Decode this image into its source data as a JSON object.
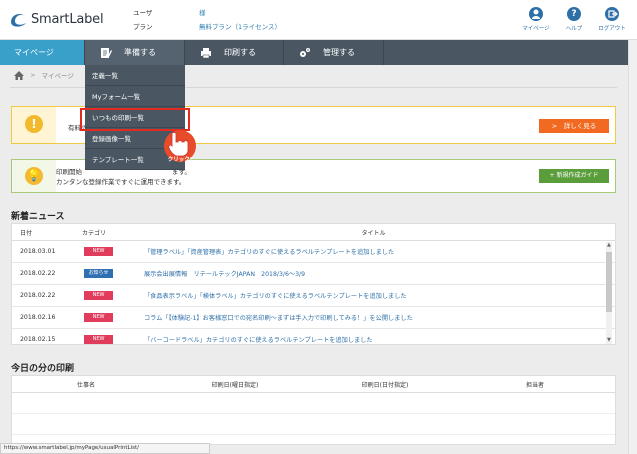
{
  "header": {
    "logo_text": "SmartLabel",
    "user_label": "ユーザ",
    "user_value": "様",
    "plan_label": "プラン",
    "plan_value": "無料プラン（1ライセンス）",
    "icons": [
      {
        "name": "mypage",
        "label": "マイページ",
        "glyph": "👤"
      },
      {
        "name": "help",
        "label": "ヘルプ",
        "glyph": "?"
      },
      {
        "name": "logout",
        "label": "ログアウト",
        "glyph": "→"
      }
    ]
  },
  "nav": {
    "mypage": "マイページ",
    "prep": "準備する",
    "print": "印刷する",
    "admin": "管理する"
  },
  "dropdown": {
    "items": [
      "定義一覧",
      "Myフォーム一覧",
      "いつもの印刷一覧",
      "登録画像一覧",
      "テンプレート一覧"
    ],
    "click_label": "クリック!"
  },
  "breadcrumb": {
    "home": "🏠",
    "sep": ">",
    "current": "マイページ"
  },
  "alert1": {
    "message": "有料の",
    "button": ">　詳しく見る"
  },
  "alert2": {
    "line1": "印刷開始",
    "line1_tail": "ます。",
    "line2": "カンタンな登録作業ですぐに運用できます。",
    "button": "+ 新規作成ガイド"
  },
  "news": {
    "title": "新着ニュース",
    "headers": {
      "date": "日付",
      "category": "カテゴリ",
      "title": "タイトル"
    },
    "rows": [
      {
        "date": "2018.03.01",
        "badge": "NEW",
        "type": "new",
        "title": "「管理ラベル」「資産管理表」カテゴリのすぐに使えるラベルテンプレートを追加しました"
      },
      {
        "date": "2018.02.22",
        "badge": "お知らせ",
        "type": "info",
        "title": "展示会出展情報　リテールテックJAPAN　2018/3/6～3/9"
      },
      {
        "date": "2018.02.22",
        "badge": "NEW",
        "type": "new",
        "title": "「食品表示ラベル」「検体ラベル」カテゴリのすぐに使えるラベルテンプレートを追加しました"
      },
      {
        "date": "2018.02.16",
        "badge": "NEW",
        "type": "new",
        "title": "コラム「【体験記-1】お客様窓口での宛名印刷～まずは手入力で印刷してみる！」を公開しました"
      },
      {
        "date": "2018.02.15",
        "badge": "NEW",
        "type": "new",
        "title": "「バーコードラベル」カテゴリのすぐに使えるラベルテンプレートを追加しました"
      }
    ]
  },
  "today": {
    "title": "今日の分の印刷",
    "headers": {
      "job": "仕事名",
      "date_day": "印刷日(曜日指定)",
      "date_date": "印刷日(日付指定)",
      "owner": "担当者"
    }
  },
  "status_bar": "https://www.smartlabel.jp/myPage/usualPrintList/",
  "colors": {
    "nav_bg": "#4a5763",
    "nav_active": "#39a0c9",
    "orange": "#f26a21",
    "green": "#5a9e3c",
    "new_badge": "#e23c5c",
    "info_badge": "#2f6fb2",
    "highlight": "#e32b1e"
  }
}
